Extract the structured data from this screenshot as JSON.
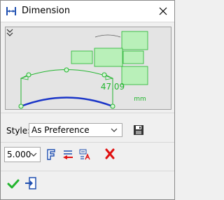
{
  "window": {
    "title": "Dimension"
  },
  "preview": {
    "value": "47.09",
    "unit": "mm"
  },
  "style": {
    "label": "Style:",
    "selected": "As Preference"
  },
  "precision": {
    "selected": "5.000"
  },
  "colors": {
    "dimension_green": "#22b52e",
    "arc_blue": "#1a35c8",
    "delete_red": "#e01010"
  },
  "icons": [
    "dimension-icon",
    "close-icon",
    "collapse-icon",
    "save-icon",
    "font-icon",
    "swap-icon",
    "text-icon",
    "delete-icon",
    "ok-icon",
    "pin-icon"
  ]
}
